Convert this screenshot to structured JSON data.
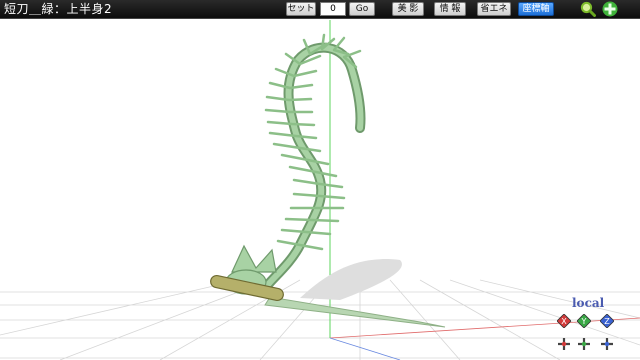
{
  "title": "短刀＿緑：上半身2",
  "frame_controls": {
    "set_label": "セット",
    "frame_value": "0",
    "go_label": "Go"
  },
  "toggle_buttons": {
    "beauty_label": "美 影",
    "info_label": "情 報",
    "save_energy_label": "省エネ",
    "axis_label": "座標軸"
  },
  "icons": {
    "zoom": "magnifier-icon",
    "move": "green-cross-move-icon"
  },
  "local_label": "local",
  "colors": {
    "titlebar": "#111111",
    "bone": "#a8d2a4",
    "bone_shadow": "#6f9a6c",
    "active_toggle": "#1d6fd6",
    "x_axis": "#d23a3a",
    "y_axis": "#39a845",
    "z_axis": "#3a62d2"
  }
}
